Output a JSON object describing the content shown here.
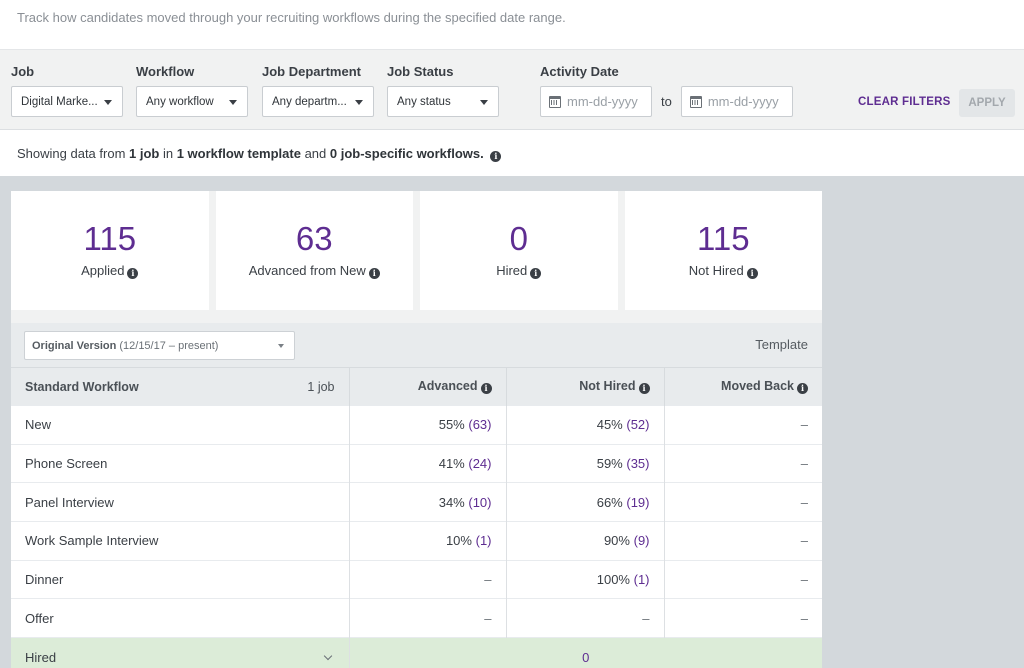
{
  "subtitle": "Track how candidates moved through your recruiting workflows during the specified date range.",
  "filters": {
    "job": {
      "label": "Job",
      "value": "Digital Marke..."
    },
    "workflow": {
      "label": "Workflow",
      "value": "Any workflow"
    },
    "department": {
      "label": "Job Department",
      "value": "Any departm..."
    },
    "status": {
      "label": "Job Status",
      "value": "Any status"
    },
    "activity_date": {
      "label": "Activity Date",
      "from_placeholder": "mm-dd-yyyy",
      "to_label": "to",
      "to_placeholder": "mm-dd-yyyy"
    },
    "clear_label": "CLEAR FILTERS",
    "apply_label": "APPLY"
  },
  "summary": {
    "prefix": "Showing data from ",
    "jobs": "1 job",
    "mid1": " in ",
    "templates": "1 workflow template",
    "mid2": " and ",
    "specific": "0 job-specific workflows.",
    "info_icon": "info-icon"
  },
  "cards": [
    {
      "value": "115",
      "label": "Applied"
    },
    {
      "value": "63",
      "label": "Advanced from New"
    },
    {
      "value": "0",
      "label": "Hired"
    },
    {
      "value": "115",
      "label": "Not Hired"
    }
  ],
  "version": {
    "name": "Original Version",
    "range": "(12/15/17 – present)",
    "template_label": "Template"
  },
  "table": {
    "headers": {
      "workflow": "Standard Workflow",
      "jobs": "1 job",
      "advanced": "Advanced",
      "not_hired": "Not Hired",
      "moved_back": "Moved Back"
    },
    "rows": [
      {
        "stage": "New",
        "advanced_pct": "55%",
        "advanced_cnt": "(63)",
        "not_hired_pct": "45%",
        "not_hired_cnt": "(52)",
        "moved_back": "–"
      },
      {
        "stage": "Phone Screen",
        "advanced_pct": "41%",
        "advanced_cnt": "(24)",
        "not_hired_pct": "59%",
        "not_hired_cnt": "(35)",
        "moved_back": "–"
      },
      {
        "stage": "Panel Interview",
        "advanced_pct": "34%",
        "advanced_cnt": "(10)",
        "not_hired_pct": "66%",
        "not_hired_cnt": "(19)",
        "moved_back": "–"
      },
      {
        "stage": "Work Sample Interview",
        "advanced_pct": "10%",
        "advanced_cnt": "(1)",
        "not_hired_pct": "90%",
        "not_hired_cnt": "(9)",
        "moved_back": "–"
      },
      {
        "stage": "Dinner",
        "advanced_pct": "–",
        "advanced_cnt": "",
        "not_hired_pct": "100%",
        "not_hired_cnt": "(1)",
        "moved_back": "–"
      },
      {
        "stage": "Offer",
        "advanced_pct": "–",
        "advanced_cnt": "",
        "not_hired_pct": "–",
        "not_hired_cnt": "",
        "moved_back": "–"
      }
    ],
    "hired_row": {
      "stage": "Hired",
      "value": "0"
    }
  },
  "colors": {
    "accent": "#5e2d91",
    "hired_bg": "#dcecd8",
    "background_gray": "#d3d8dc"
  }
}
